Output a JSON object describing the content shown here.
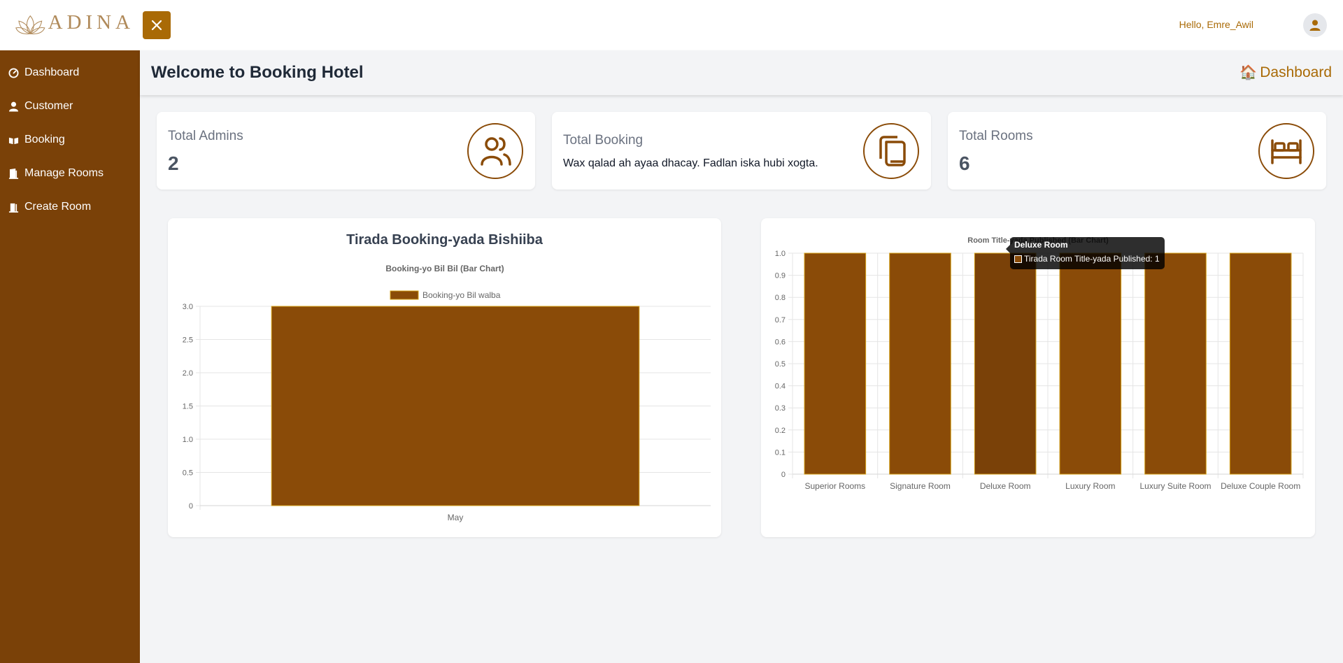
{
  "brand": {
    "name": "ADINA"
  },
  "header": {
    "greeting": "Hello, Emre_Awil"
  },
  "sidebar": {
    "items": [
      {
        "label": "Dashboard",
        "icon": "dashboard-icon"
      },
      {
        "label": "Customer",
        "icon": "user-icon"
      },
      {
        "label": "Booking",
        "icon": "booking-icon"
      },
      {
        "label": "Manage Rooms",
        "icon": "door-icon"
      },
      {
        "label": "Create Room",
        "icon": "door-icon"
      }
    ]
  },
  "page": {
    "title": "Welcome to Booking Hotel",
    "breadcrumb": "Dashboard"
  },
  "stats": [
    {
      "label": "Total Admins",
      "value": "2",
      "icon": "users-icon"
    },
    {
      "label": "Total Booking",
      "note": "Wax qalad ah ayaa dhacay. Fadlan iska hubi xogta.",
      "icon": "booking-copy-icon"
    },
    {
      "label": "Total Rooms",
      "value": "6",
      "icon": "bed-icon"
    }
  ],
  "colors": {
    "accent": "#a96a06",
    "sidebar": "#7a4108",
    "bar": "#8a4b08",
    "bar_border": "#d4a017"
  },
  "chart_data": [
    {
      "type": "bar",
      "panel_title": "Tirada Booking-yada Bishiiba",
      "title": "Booking-yo Bil Bil (Bar Chart)",
      "categories": [
        "May"
      ],
      "series": [
        {
          "name": "Booking-yo Bil walba",
          "values": [
            3
          ]
        }
      ],
      "ylim": [
        0,
        3
      ],
      "yticks": [
        "0",
        "0.5",
        "1.0",
        "1.5",
        "2.0",
        "2.5",
        "3.0"
      ],
      "grid": true,
      "legend": "top"
    },
    {
      "type": "bar",
      "title": "Room Title-yada Published (Bar Chart)",
      "categories": [
        "Superior Rooms",
        "Signature Room",
        "Deluxe Room",
        "Luxury Room",
        "Luxury Suite Room",
        "Deluxe Couple Room"
      ],
      "series": [
        {
          "name": "Tirada Room Title-yada Published",
          "values": [
            1,
            1,
            1,
            1,
            1,
            1
          ]
        }
      ],
      "ylim": [
        0,
        1
      ],
      "yticks": [
        "0",
        "0.1",
        "0.2",
        "0.3",
        "0.4",
        "0.5",
        "0.6",
        "0.7",
        "0.8",
        "0.9",
        "1.0"
      ],
      "grid": true,
      "legend": "none"
    }
  ],
  "tooltip": {
    "title": "Deluxe Room",
    "text": "Tirada Room Title-yada Published: 1"
  }
}
